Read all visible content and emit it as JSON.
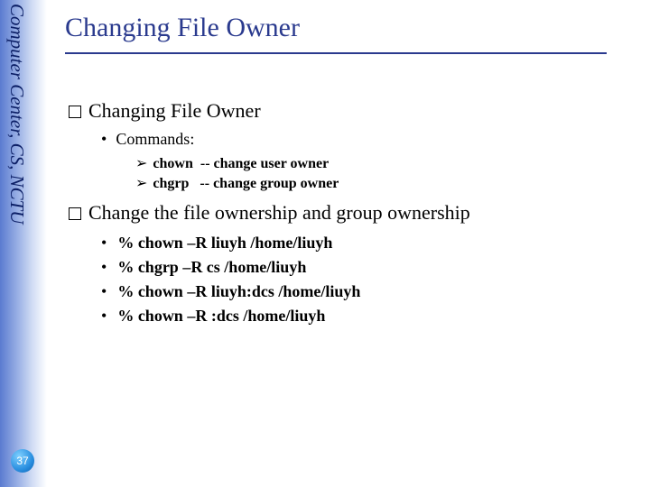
{
  "sidebar": {
    "org_text": "Computer Center, CS, NCTU"
  },
  "title": "Changing File Owner",
  "sections": [
    {
      "heading": "Changing File Owner",
      "sub": {
        "label": "Commands:",
        "items": [
          {
            "cmd": "chown",
            "sep": "-- ",
            "desc": "change user owner"
          },
          {
            "cmd": "chgrp",
            "sep": "-- ",
            "desc": "change group owner"
          }
        ]
      }
    },
    {
      "heading": "Change the file ownership and group ownership",
      "examples": [
        "% chown –R liuyh /home/liuyh",
        "% chgrp –R cs /home/liuyh",
        "% chown –R liuyh:dcs /home/liuyh",
        "% chown –R :dcs /home/liuyh"
      ]
    }
  ],
  "page_number": "37",
  "colors": {
    "accent": "#2a3a8e",
    "sidebar_from": "#5a7bd0",
    "sidebar_to": "#ffffff"
  }
}
